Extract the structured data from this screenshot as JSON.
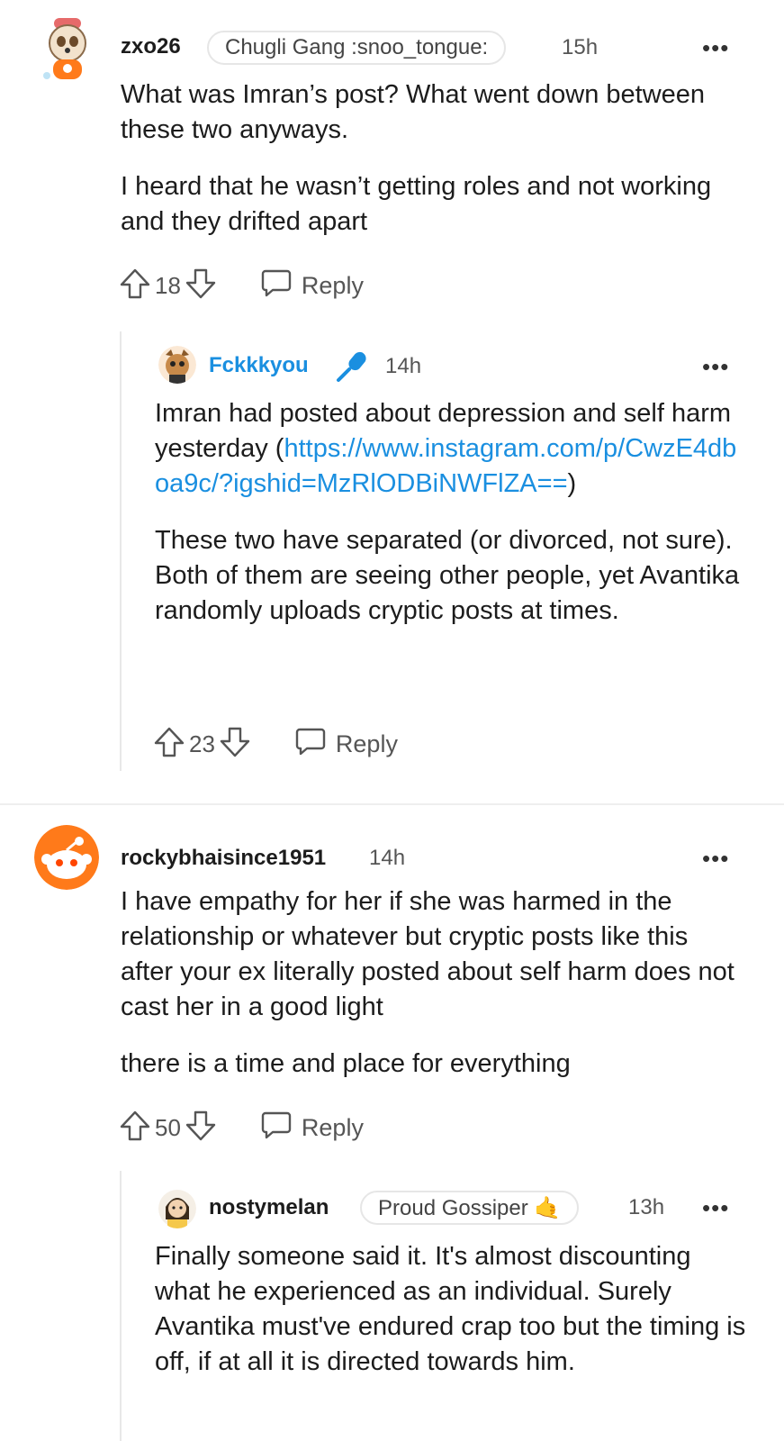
{
  "comments": [
    {
      "username": "zxo26",
      "flair": "Chugli Gang :snoo_tongue:",
      "time": "15h",
      "paragraphs": [
        "What was Imran’s post? What went down between these two anyways.",
        "I heard that he wasn’t getting roles and not working and they drifted apart"
      ],
      "votes": "18",
      "reply_label": "Reply"
    },
    {
      "username": "Fckkkyou",
      "time": "14h",
      "paragraph1_before": "Imran had posted about depression and self harm yesterday (",
      "paragraph1_link": "https://www.instagram.com/p/CwzE4dboa9c/?igshid=MzRlODBiNWFlZA==",
      "paragraph1_after": ")",
      "paragraph2": "These two have separated (or divorced, not sure). Both of them are seeing other people, yet Avantika randomly uploads cryptic posts at times.",
      "votes": "23",
      "reply_label": "Reply"
    },
    {
      "username": "rockybhaisince1951",
      "time": "14h",
      "paragraphs": [
        "I have empathy for her if she was harmed in the relationship or whatever but cryptic posts like this after your ex literally posted about self harm does not cast her in a good light",
        "there is a time and place for everything"
      ],
      "votes": "50",
      "reply_label": "Reply"
    },
    {
      "username": "nostymelan",
      "flair": "Proud Gossiper 🤙",
      "time": "13h",
      "paragraphs": [
        "Finally someone said it. It's almost discounting what he experienced as an individual. Surely Avantika must've endured crap too but the timing is off, if at all it is directed towards him."
      ]
    }
  ],
  "more_label": "•••",
  "colors": {
    "link": "#1a8fe0",
    "orange": "#ff7a1a",
    "text": "#1c1c1c",
    "meta": "#555555"
  }
}
